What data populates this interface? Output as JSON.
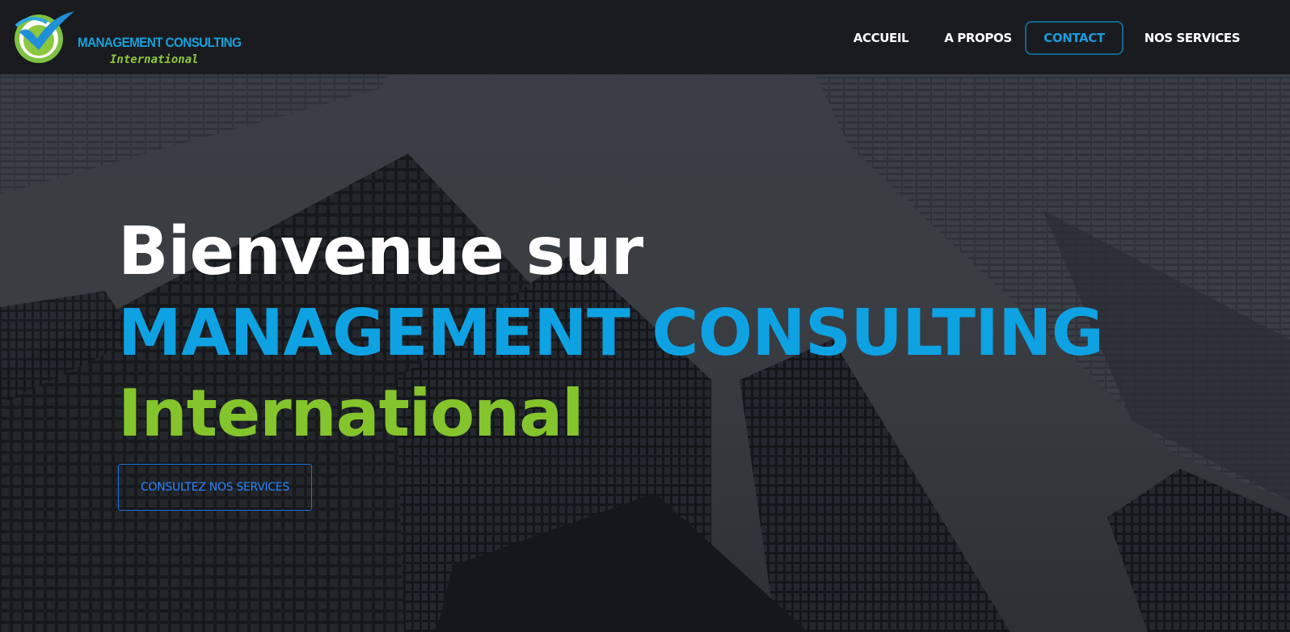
{
  "brand": {
    "name": "MANAGEMENT CONSULTING",
    "tagline": "International",
    "logo_icon": "checkmark-globe-icon",
    "colors": {
      "blue": "#16a2dd",
      "green": "#8dc63f"
    }
  },
  "nav": {
    "items": [
      {
        "label": "ACCUEIL",
        "active": false
      },
      {
        "label": "A PROPOS",
        "active": false
      },
      {
        "label": "CONTACT",
        "active": true
      },
      {
        "label": "NOS SERVICES",
        "active": false
      }
    ]
  },
  "hero": {
    "greeting": "Bienvenue sur",
    "company": "MANAGEMENT CONSULTING",
    "suffix": "International",
    "cta_label": "CONSULTEZ NOS SERVICES",
    "background": "dark-skyscrapers-photo"
  },
  "theme": {
    "accent": "#0ea2e3",
    "secondary": "#84c42c",
    "header_bg": "#18191b",
    "cta_border": "#1d72d8"
  }
}
